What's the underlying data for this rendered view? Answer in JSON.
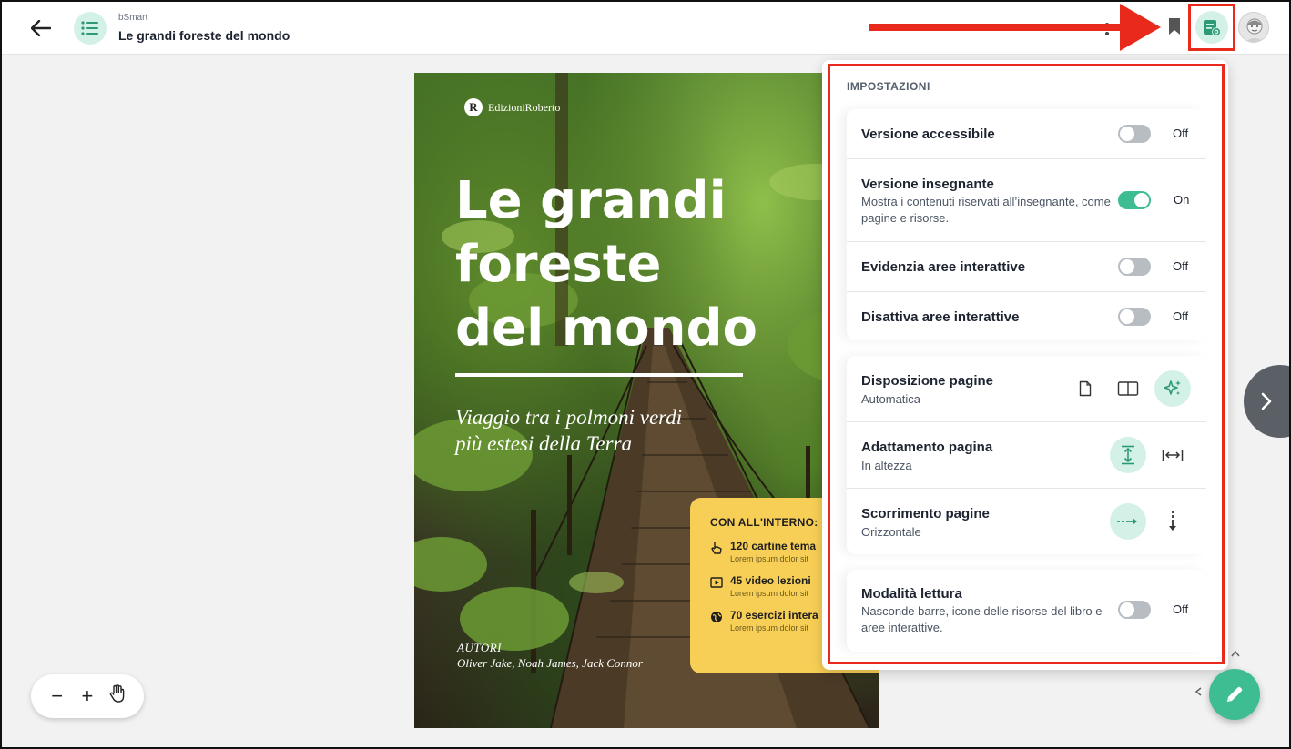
{
  "header": {
    "brand": "bSmart",
    "title": "Le grandi foreste del mondo"
  },
  "cover": {
    "publisher": "EdizioniRoberto",
    "publisher_logo_letter": "R",
    "title_lines": [
      "Le grandi",
      "foreste",
      "del mondo"
    ],
    "subtitle_lines": [
      "Viaggio tra i polmoni verdi",
      "più estesi della Terra"
    ],
    "authors_label": "AUTORI",
    "authors": "Oliver Jake, Noah James, Jack Connor",
    "inside": {
      "title": "CON ALL'INTERNO:",
      "items": [
        {
          "main": "120 cartine tema",
          "sub": "Lorem ipsum dolor sit",
          "icon": "hand-pointer-icon"
        },
        {
          "main": "45 video lezioni",
          "sub": "Lorem ipsum dolor sit",
          "icon": "video-icon"
        },
        {
          "main": "70 esercizi intera",
          "sub": "Lorem ipsum dolor sit",
          "icon": "globe-icon"
        }
      ]
    }
  },
  "settings": {
    "heading": "IMPOSTAZIONI",
    "toggles": [
      {
        "title": "Versione accessibile",
        "desc": "",
        "state": "Off"
      },
      {
        "title": "Versione insegnante",
        "desc": "Mostra i contenuti riservati all’insegnante, come pagine e risorse.",
        "state": "On"
      },
      {
        "title": "Evidenzia aree interattive",
        "desc": "",
        "state": "Off"
      },
      {
        "title": "Disattiva aree interattive",
        "desc": "",
        "state": "Off"
      }
    ],
    "layout": {
      "title": "Disposizione pagine",
      "value": "Automatica"
    },
    "fit": {
      "title": "Adattamento pagina",
      "value": "In altezza"
    },
    "scroll": {
      "title": "Scorrimento pagine",
      "value": "Orizzontale"
    },
    "reading": {
      "title": "Modalità lettura",
      "desc": "Nasconde barre, icone delle risorse del libro e aree interattive.",
      "state": "Off"
    }
  },
  "zoom": {
    "minus": "−",
    "plus": "+"
  },
  "colors": {
    "accent": "#3fbd92",
    "accent_light": "#d4f1e7",
    "highlight_red": "#e8291b",
    "badge_yellow": "#f8cf56"
  }
}
